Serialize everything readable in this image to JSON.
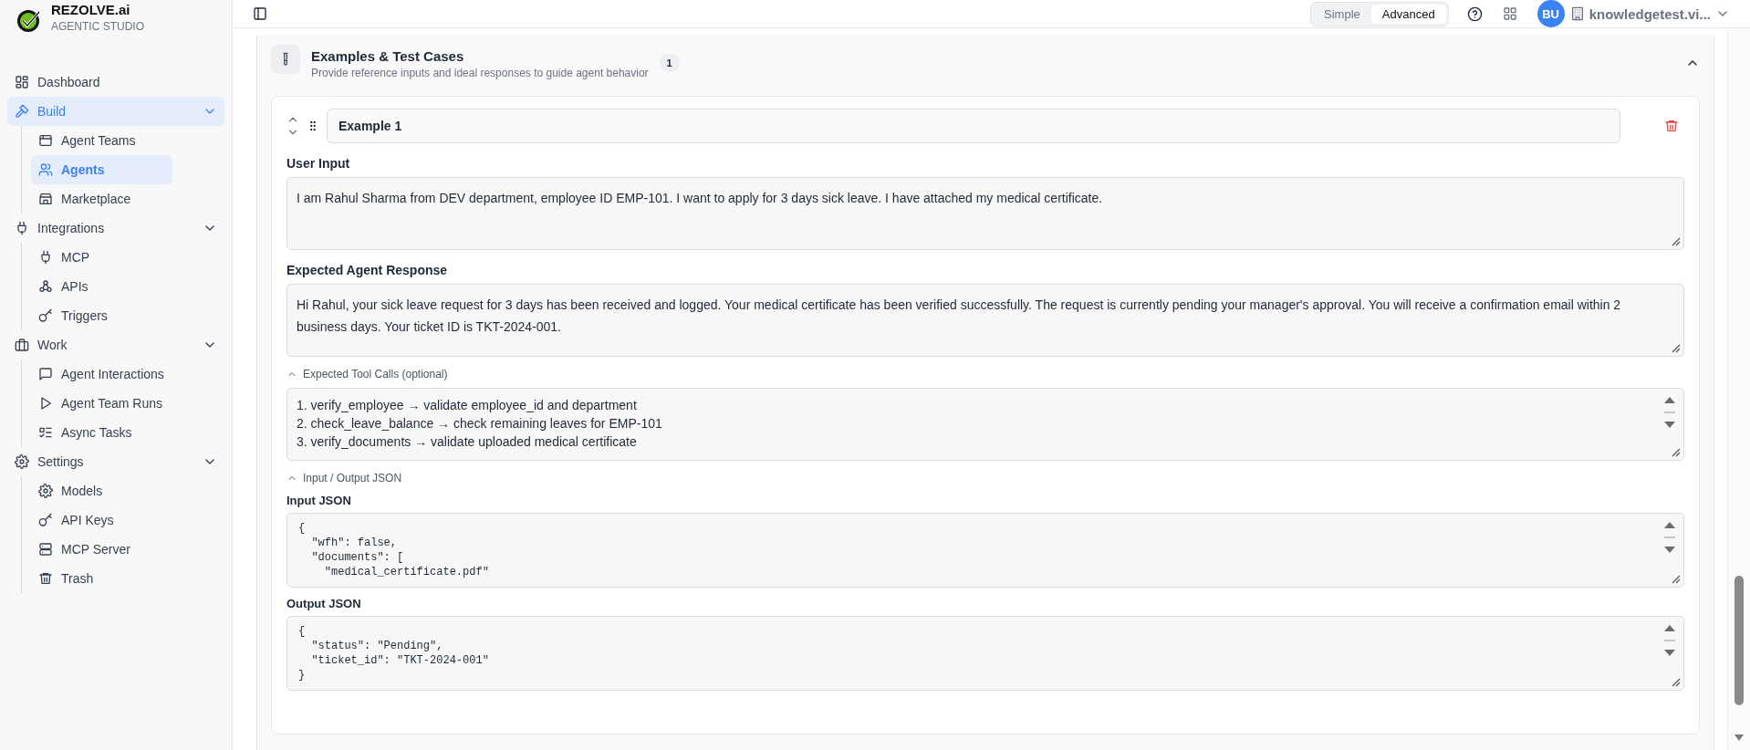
{
  "sidebar": {
    "brand": {
      "name": "REZOLVE.ai",
      "subtitle": "AGENTIC STUDIO"
    },
    "nav": [
      {
        "label": "Dashboard",
        "selected": false
      },
      {
        "label": "Build",
        "selected": true,
        "expanded": true,
        "children": [
          {
            "label": "Agent Teams",
            "selected": false
          },
          {
            "label": "Agents",
            "selected": true
          },
          {
            "label": "Marketplace",
            "selected": false
          }
        ]
      },
      {
        "label": "Integrations",
        "selected": false,
        "expanded": true,
        "children": [
          {
            "label": "MCP",
            "selected": false
          },
          {
            "label": "APIs",
            "selected": false
          },
          {
            "label": "Triggers",
            "selected": false
          }
        ]
      },
      {
        "label": "Work",
        "selected": false,
        "expanded": true,
        "children": [
          {
            "label": "Agent Interactions",
            "selected": false
          },
          {
            "label": "Agent Team Runs",
            "selected": false
          },
          {
            "label": "Async Tasks",
            "selected": false
          }
        ]
      },
      {
        "label": "Settings",
        "selected": false,
        "expanded": true,
        "children": [
          {
            "label": "Models",
            "selected": false
          },
          {
            "label": "API Keys",
            "selected": false
          },
          {
            "label": "MCP Server",
            "selected": false
          },
          {
            "label": "Trash",
            "selected": false
          }
        ]
      }
    ]
  },
  "topbar": {
    "mode_toggle": [
      {
        "label": "Simple",
        "selected": false
      },
      {
        "label": "Advanced",
        "selected": true
      }
    ],
    "avatar": "BU",
    "workspace": "knowledgetest.vi..."
  },
  "section": {
    "title": "Examples & Test Cases",
    "subtitle": "Provide reference inputs and ideal responses to guide agent behavior",
    "count": "1",
    "expanded": true,
    "example": {
      "name": "Example 1",
      "user_input": {
        "label": "User Input",
        "value": "I am Rahul Sharma from DEV department, employee ID EMP-101. I want to apply for 3 days sick leave. I have attached my medical certificate."
      },
      "expected_response": {
        "label": "Expected Agent Response",
        "value": "Hi Rahul, your sick leave request for 3 days has been received and logged. Your medical certificate has been verified successfully. The request is currently pending your manager's approval. You will receive a confirmation email within 2 business days. Your ticket ID is TKT-2024-001."
      },
      "tool_calls": {
        "label": "Expected Tool Calls (optional)",
        "expanded": true,
        "lines": [
          "1. verify_employee → validate employee_id and department",
          "2. check_leave_balance → check remaining leaves for EMP-101",
          "3. verify_documents → validate uploaded medical certificate"
        ]
      },
      "io_json": {
        "label": "Input / Output JSON",
        "expanded": true,
        "input": {
          "label": "Input JSON",
          "lines": [
            "{",
            "  \"wfh\": false,",
            "  \"documents\": [",
            "    \"medical_certificate.pdf\""
          ]
        },
        "output": {
          "label": "Output JSON",
          "lines": [
            "{",
            "  \"status\": \"Pending\",",
            "  \"ticket_id\": \"TKT-2024-001\"",
            "}"
          ]
        }
      }
    }
  }
}
